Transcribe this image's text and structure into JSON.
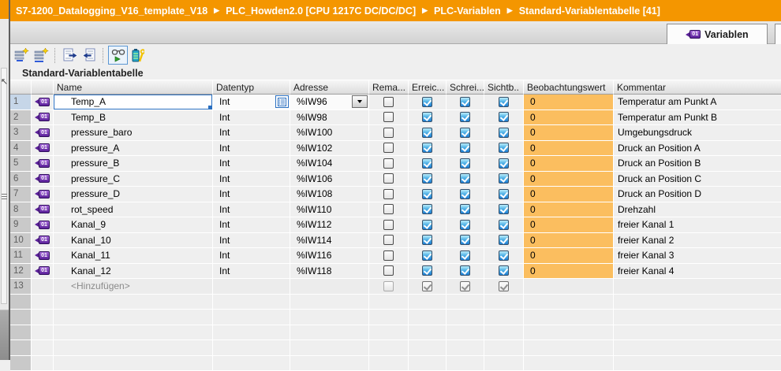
{
  "colors": {
    "accent_orange": "#F49600",
    "monitor_cell_orange": "#FBBE5F",
    "checkbox_blue": "#1D7DD2",
    "tag_purple": "#5B2099",
    "selection_blue": "#2A6FC0"
  },
  "breadcrumb": {
    "separator": "▶",
    "segments": [
      "S7-1200_Datalogging_V16_template_V18",
      "PLC_Howden2.0 [CPU 1217C DC/DC/DC]",
      "PLC-Variablen",
      "Standard-Variablentabelle [41]"
    ]
  },
  "editor_tab": {
    "label": "Variablen",
    "icon": "variable-tag-icon",
    "tag_glyph": "01"
  },
  "toolbar": {
    "buttons": [
      {
        "name": "add-row-button",
        "icon": "add-row-star-icon"
      },
      {
        "name": "insert-row-button",
        "icon": "insert-row-star-icon"
      },
      {
        "name": "export-button",
        "icon": "page-arrow-right-icon"
      },
      {
        "name": "import-button",
        "icon": "page-arrow-left-icon"
      },
      {
        "name": "monitor-all-button",
        "icon": "glasses-monitor-icon",
        "active": true
      },
      {
        "name": "retain-button",
        "icon": "battery-wrench-icon"
      }
    ]
  },
  "table": {
    "title": "Standard-Variablentabelle",
    "headers": {
      "num": "",
      "icon": "",
      "name": "Name",
      "datentyp": "Datentyp",
      "adresse": "Adresse",
      "rema": "Rema...",
      "erreic": "Erreic...",
      "schrei": "Schrei...",
      "sichtb": "Sichtb..",
      "beob": "Beobachtungswert",
      "kommentar": "Kommentar"
    },
    "rows": [
      {
        "num": "1",
        "name": "Temp_A",
        "datentyp": "Int",
        "adresse": "%IW96",
        "rema": false,
        "erreic": true,
        "schrei": true,
        "sichtb": true,
        "beobachtungswert": "0",
        "kommentar": "Temperatur am Punkt A",
        "selected": true
      },
      {
        "num": "2",
        "name": "Temp_B",
        "datentyp": "Int",
        "adresse": "%IW98",
        "rema": false,
        "erreic": true,
        "schrei": true,
        "sichtb": true,
        "beobachtungswert": "0",
        "kommentar": "Temperatur am Punkt B",
        "selected": false
      },
      {
        "num": "3",
        "name": "pressure_baro",
        "datentyp": "Int",
        "adresse": "%IW100",
        "rema": false,
        "erreic": true,
        "schrei": true,
        "sichtb": true,
        "beobachtungswert": "0",
        "kommentar": "Umgebungsdruck",
        "selected": false
      },
      {
        "num": "4",
        "name": "pressure_A",
        "datentyp": "Int",
        "adresse": "%IW102",
        "rema": false,
        "erreic": true,
        "schrei": true,
        "sichtb": true,
        "beobachtungswert": "0",
        "kommentar": "Druck an Position A",
        "selected": false
      },
      {
        "num": "5",
        "name": "pressure_B",
        "datentyp": "Int",
        "adresse": "%IW104",
        "rema": false,
        "erreic": true,
        "schrei": true,
        "sichtb": true,
        "beobachtungswert": "0",
        "kommentar": "Druck an Position B",
        "selected": false
      },
      {
        "num": "6",
        "name": "pressure_C",
        "datentyp": "Int",
        "adresse": "%IW106",
        "rema": false,
        "erreic": true,
        "schrei": true,
        "sichtb": true,
        "beobachtungswert": "0",
        "kommentar": "Druck an Position C",
        "selected": false
      },
      {
        "num": "7",
        "name": "pressure_D",
        "datentyp": "Int",
        "adresse": "%IW108",
        "rema": false,
        "erreic": true,
        "schrei": true,
        "sichtb": true,
        "beobachtungswert": "0",
        "kommentar": "Druck an Position D",
        "selected": false
      },
      {
        "num": "8",
        "name": "rot_speed",
        "datentyp": "Int",
        "adresse": "%IW110",
        "rema": false,
        "erreic": true,
        "schrei": true,
        "sichtb": true,
        "beobachtungswert": "0",
        "kommentar": "Drehzahl",
        "selected": false
      },
      {
        "num": "9",
        "name": "Kanal_9",
        "datentyp": "Int",
        "adresse": "%IW112",
        "rema": false,
        "erreic": true,
        "schrei": true,
        "sichtb": true,
        "beobachtungswert": "0",
        "kommentar": "freier Kanal 1",
        "selected": false
      },
      {
        "num": "10",
        "name": "Kanal_10",
        "datentyp": "Int",
        "adresse": "%IW114",
        "rema": false,
        "erreic": true,
        "schrei": true,
        "sichtb": true,
        "beobachtungswert": "0",
        "kommentar": "freier Kanal 2",
        "selected": false
      },
      {
        "num": "11",
        "name": "Kanal_11",
        "datentyp": "Int",
        "adresse": "%IW116",
        "rema": false,
        "erreic": true,
        "schrei": true,
        "sichtb": true,
        "beobachtungswert": "0",
        "kommentar": "freier Kanal 3",
        "selected": false
      },
      {
        "num": "12",
        "name": "Kanal_12",
        "datentyp": "Int",
        "adresse": "%IW118",
        "rema": false,
        "erreic": true,
        "schrei": true,
        "sichtb": true,
        "beobachtungswert": "0",
        "kommentar": "freier Kanal 4",
        "selected": false
      }
    ],
    "add_row": {
      "num": "13",
      "label": "<Hinzufügen>",
      "erreic": true,
      "schrei": true,
      "sichtb": true
    },
    "empty_row_count": 5,
    "tag_glyph": "01"
  }
}
